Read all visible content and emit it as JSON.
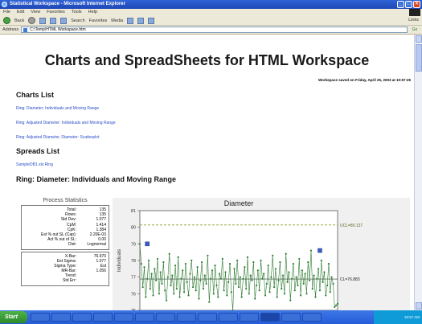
{
  "window": {
    "title": "Statistical Workspace - Microsoft Internet Explorer"
  },
  "menu": [
    "File",
    "Edit",
    "View",
    "Favorites",
    "Tools",
    "Help"
  ],
  "toolbar": {
    "back": "Back",
    "search": "Search",
    "favorites": "Favorites",
    "media": "Media",
    "links": "Links"
  },
  "address": {
    "label": "Address",
    "value": "C:\\Temp\\HTML Workspace.htm",
    "go": "Go"
  },
  "page": {
    "title": "Charts and SpreadSheets for HTML Workspace",
    "saved_note": "Workspace saved on Friday, April 25, 2003 at 10:57:25",
    "charts_heading": "Charts List",
    "charts": [
      "Ring: Diameter: Individuals and Moving Range",
      "Ring: Adjusted Diameter: Individuals and Moving Range",
      "Ring: Adjusted Diameter, Diameter: Scatterplot"
    ],
    "spreads_heading": "Spreads List",
    "spreads": [
      "SampleDB1.xls:Ring"
    ],
    "section_heading": "Ring: Diameter: Individuals and Moving Range"
  },
  "stats": {
    "title": "Process Statistics",
    "block1": [
      {
        "label": "Total:",
        "value": "135"
      },
      {
        "label": "Rows:",
        "value": "135"
      },
      {
        "label": "Std Dev:",
        "value": "1.077"
      },
      {
        "label": "CpM:",
        "value": "1.414"
      },
      {
        "label": "CpK:",
        "value": "1.384"
      },
      {
        "label": "Est % out SL (Cap):",
        "value": "2.20E-03"
      },
      {
        "label": "Act % out of SL:",
        "value": "0.00"
      },
      {
        "label": "Dist:",
        "value": "Lognormal"
      }
    ],
    "block2": [
      {
        "label": "X-Bar:",
        "value": "76.970"
      },
      {
        "label": "Est Sigma:",
        "value": "1.077"
      },
      {
        "label": "Sigma Type:",
        "value": "Est"
      },
      {
        "label": "MR-Bar:",
        "value": "1.056"
      },
      {
        "label": "Trend:",
        "value": ""
      },
      {
        "label": "Std Err:",
        "value": ""
      }
    ]
  },
  "chart_data": {
    "type": "line",
    "title": "Diameter",
    "ylabel": "Individuals",
    "ylim": [
      75,
      81
    ],
    "yticks": [
      75,
      76,
      77,
      78,
      79,
      80,
      81
    ],
    "ucl": 80.137,
    "ucl_label": "UCL=80.137",
    "cl": 76.883,
    "cl_label": "CL=76.883",
    "x": [
      1,
      2,
      3,
      4,
      5,
      6,
      7,
      8,
      9,
      10,
      11,
      12,
      13,
      14,
      15,
      16,
      17,
      18,
      19,
      20,
      21,
      22,
      23,
      24,
      25,
      26,
      27,
      28,
      29,
      30,
      31,
      32,
      33,
      34,
      35,
      36,
      37,
      38,
      39,
      40,
      41,
      42,
      43,
      44,
      45,
      46,
      47,
      48,
      49,
      50,
      51,
      52,
      53,
      54,
      55,
      56,
      57,
      58,
      59,
      60,
      61,
      62,
      63,
      64,
      65,
      66,
      67,
      68,
      69,
      70,
      71,
      72,
      73,
      74,
      75,
      76,
      77,
      78,
      79,
      80,
      81,
      82,
      83,
      84,
      85,
      86,
      87,
      88,
      89,
      90,
      91,
      92,
      93,
      94,
      95,
      96,
      97,
      98,
      99,
      100,
      101,
      102,
      103,
      104,
      105,
      106,
      107,
      108,
      109,
      110,
      111,
      112,
      113,
      114,
      115,
      116,
      117,
      118,
      119,
      120,
      121,
      122,
      123,
      124,
      125,
      126,
      127,
      128,
      129,
      130,
      131,
      132,
      133,
      134,
      135
    ],
    "values": [
      79.0,
      77.8,
      76.4,
      77.6,
      75.8,
      76.9,
      78.0,
      76.3,
      77.2,
      75.9,
      77.5,
      76.8,
      78.1,
      76.0,
      77.3,
      76.6,
      77.9,
      76.2,
      75.6,
      77.0,
      78.4,
      76.5,
      77.1,
      76.0,
      77.7,
      76.3,
      78.2,
      75.8,
      76.9,
      77.4,
      76.1,
      77.8,
      76.7,
      75.9,
      77.2,
      78.0,
      76.4,
      77.0,
      76.2,
      77.6,
      75.7,
      76.8,
      77.9,
      76.3,
      77.1,
      76.6,
      78.3,
      75.5,
      76.9,
      77.4,
      76.0,
      77.7,
      76.5,
      75.8,
      77.2,
      76.9,
      78.1,
      76.2,
      77.3,
      75.9,
      76.7,
      77.8,
      76.1,
      75.0,
      77.5,
      76.6,
      78.0,
      76.4,
      77.0,
      75.8,
      76.9,
      77.6,
      76.3,
      78.2,
      76.0,
      77.1,
      76.8,
      77.9,
      75.7,
      76.5,
      77.4,
      76.2,
      78.0,
      76.9,
      77.2,
      75.9,
      76.6,
      77.7,
      76.1,
      77.0,
      78.3,
      76.4,
      77.5,
      75.8,
      76.8,
      77.9,
      76.3,
      77.1,
      76.0,
      78.4,
      76.7,
      77.3,
      75.6,
      76.9,
      77.8,
      76.2,
      77.0,
      76.5,
      78.1,
      75.9,
      77.4,
      76.6,
      77.2,
      76.0,
      77.9,
      76.8,
      78.6,
      76.3,
      77.1,
      75.8,
      76.9,
      77.5,
      76.2,
      78.0,
      76.7,
      77.3,
      75.9,
      76.5,
      77.8,
      76.1,
      77.0,
      76.6,
      75.2,
      75.3,
      75.4
    ],
    "marked_points": [
      {
        "x": 6,
        "y": 79.0
      },
      {
        "x": 123,
        "y": 78.6
      }
    ],
    "colors": {
      "line": "#2e7d32",
      "points": "#2e7d32",
      "ucl": "#8fa02a",
      "cl": "#333333",
      "marker": "#3a5fcd"
    }
  },
  "taskbar": {
    "start": "Start",
    "items": [
      "",
      "",
      "",
      "",
      "",
      "",
      "",
      "",
      "",
      "",
      "",
      "",
      "",
      ""
    ],
    "clock": "10:57 AM"
  }
}
